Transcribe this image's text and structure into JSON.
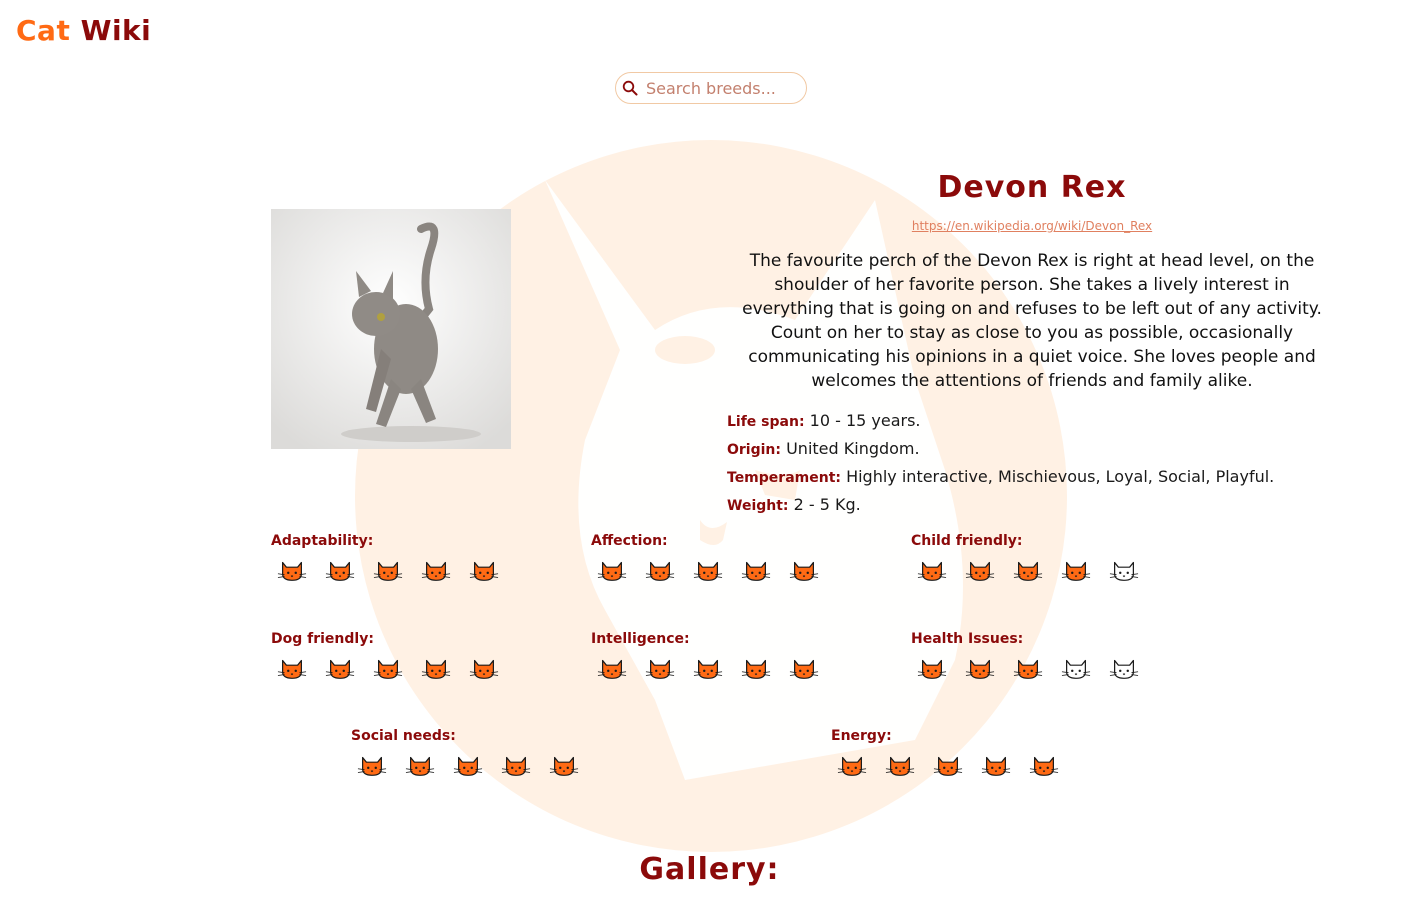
{
  "header": {
    "logo_word1": "Cat",
    "logo_word2": "Wiki"
  },
  "search": {
    "placeholder": "Search breeds..."
  },
  "breed": {
    "name": "Devon Rex",
    "wiki_url": "https://en.wikipedia.org/wiki/Devon_Rex",
    "description": "The favourite perch of the Devon Rex is right at head level, on the shoulder of her favorite person. She takes a lively interest in everything that is going on and refuses to be left out of any activity. Count on her to stay as close to you as possible, occasionally communicating his opinions in a quiet voice. She loves people and welcomes the attentions of friends and family alike.",
    "facts": [
      {
        "label": "Life span:",
        "value": "10 - 15 years."
      },
      {
        "label": "Origin:",
        "value": "United Kingdom."
      },
      {
        "label": "Temperament:",
        "value": "Highly interactive, Mischievous, Loyal, Social, Playful."
      },
      {
        "label": "Weight:",
        "value": "2 - 5 Kg."
      }
    ]
  },
  "ratings": [
    {
      "label": "Adaptability:",
      "score": 5,
      "max": 5
    },
    {
      "label": "Affection:",
      "score": 5,
      "max": 5
    },
    {
      "label": "Child friendly:",
      "score": 4,
      "max": 5
    },
    {
      "label": "Dog friendly:",
      "score": 5,
      "max": 5
    },
    {
      "label": "Intelligence:",
      "score": 5,
      "max": 5
    },
    {
      "label": "Health Issues:",
      "score": 3,
      "max": 5
    },
    {
      "label": "Social needs:",
      "score": 5,
      "max": 5
    },
    {
      "label": "Energy:",
      "score": 5,
      "max": 5
    }
  ],
  "gallery": {
    "title": "Gallery:"
  },
  "colors": {
    "accent_orange": "#ff6a14",
    "brand_red": "#8b0a0a",
    "bg_cat": "#fff1e4"
  },
  "icons": {
    "search": "search-icon",
    "rating": "cat-face-icon",
    "background": "cat-silhouette-icon"
  }
}
